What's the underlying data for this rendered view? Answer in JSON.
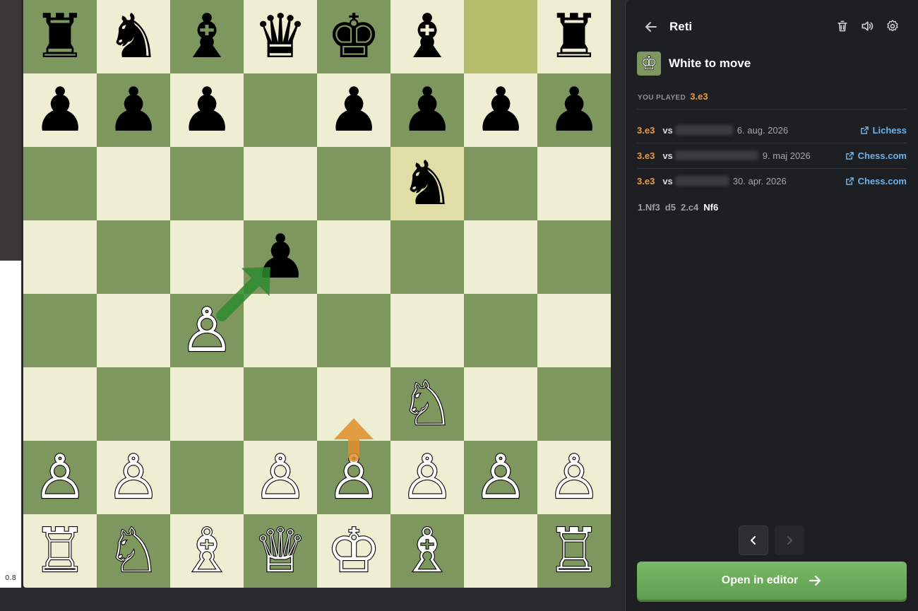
{
  "evaluation": {
    "label": "0.8",
    "white_fraction": 0.556
  },
  "board": {
    "colors": {
      "light": "#eeeed2",
      "dark": "#7d975e",
      "highlight_light": "#e0dea5",
      "highlight_dark": "#b3bd6b",
      "arrow_green": "#2f8a2f",
      "arrow_orange": "#e08e2c"
    },
    "highlighted_squares": [
      "g8",
      "f6"
    ],
    "pieces": [
      {
        "sq": "a8",
        "glyph": "♜",
        "color": "b"
      },
      {
        "sq": "b8",
        "glyph": "♞",
        "color": "b"
      },
      {
        "sq": "c8",
        "glyph": "♝",
        "color": "b"
      },
      {
        "sq": "d8",
        "glyph": "♛",
        "color": "b"
      },
      {
        "sq": "e8",
        "glyph": "♚",
        "color": "b"
      },
      {
        "sq": "f8",
        "glyph": "♝",
        "color": "b"
      },
      {
        "sq": "h8",
        "glyph": "♜",
        "color": "b"
      },
      {
        "sq": "a7",
        "glyph": "♟",
        "color": "b"
      },
      {
        "sq": "b7",
        "glyph": "♟",
        "color": "b"
      },
      {
        "sq": "c7",
        "glyph": "♟",
        "color": "b"
      },
      {
        "sq": "e7",
        "glyph": "♟",
        "color": "b"
      },
      {
        "sq": "f7",
        "glyph": "♟",
        "color": "b"
      },
      {
        "sq": "g7",
        "glyph": "♟",
        "color": "b"
      },
      {
        "sq": "h7",
        "glyph": "♟",
        "color": "b"
      },
      {
        "sq": "f6",
        "glyph": "♞",
        "color": "b"
      },
      {
        "sq": "d5",
        "glyph": "♟",
        "color": "b"
      },
      {
        "sq": "c4",
        "glyph": "♙",
        "color": "w"
      },
      {
        "sq": "f3",
        "glyph": "♘",
        "color": "w"
      },
      {
        "sq": "a2",
        "glyph": "♙",
        "color": "w"
      },
      {
        "sq": "b2",
        "glyph": "♙",
        "color": "w"
      },
      {
        "sq": "d2",
        "glyph": "♙",
        "color": "w"
      },
      {
        "sq": "e2",
        "glyph": "♙",
        "color": "w"
      },
      {
        "sq": "f2",
        "glyph": "♙",
        "color": "w"
      },
      {
        "sq": "g2",
        "glyph": "♙",
        "color": "w"
      },
      {
        "sq": "h2",
        "glyph": "♙",
        "color": "w"
      },
      {
        "sq": "a1",
        "glyph": "♖",
        "color": "w"
      },
      {
        "sq": "b1",
        "glyph": "♘",
        "color": "w"
      },
      {
        "sq": "c1",
        "glyph": "♗",
        "color": "w"
      },
      {
        "sq": "d1",
        "glyph": "♕",
        "color": "w"
      },
      {
        "sq": "e1",
        "glyph": "♔",
        "color": "w"
      },
      {
        "sq": "f1",
        "glyph": "♗",
        "color": "w"
      },
      {
        "sq": "h1",
        "glyph": "♖",
        "color": "w"
      }
    ],
    "arrows": [
      {
        "name": "suggested-move-arrow",
        "from": "c4",
        "to": "d5",
        "color": "#2f8a2f"
      },
      {
        "name": "played-move-arrow",
        "from": "e2",
        "to": "e3",
        "color": "#e08e2c"
      }
    ]
  },
  "panel": {
    "title": "Reti",
    "side_to_move": "White to move",
    "side_to_move_glyph": "♔",
    "you_played_label": "YOU PLAYED",
    "you_played_move": "3.e3",
    "games": [
      {
        "move": "3.e3",
        "vs": "vs",
        "date": "6. aug. 2026",
        "site": "Lichess"
      },
      {
        "move": "3.e3",
        "vs": "vs",
        "date": "9. maj 2026",
        "site": "Chess.com"
      },
      {
        "move": "3.e3",
        "vs": "vs",
        "date": "30. apr. 2026",
        "site": "Chess.com"
      }
    ],
    "moves": [
      "1.Nf3",
      "d5",
      "2.c4",
      "Nf6"
    ],
    "open_button": "Open in editor"
  }
}
